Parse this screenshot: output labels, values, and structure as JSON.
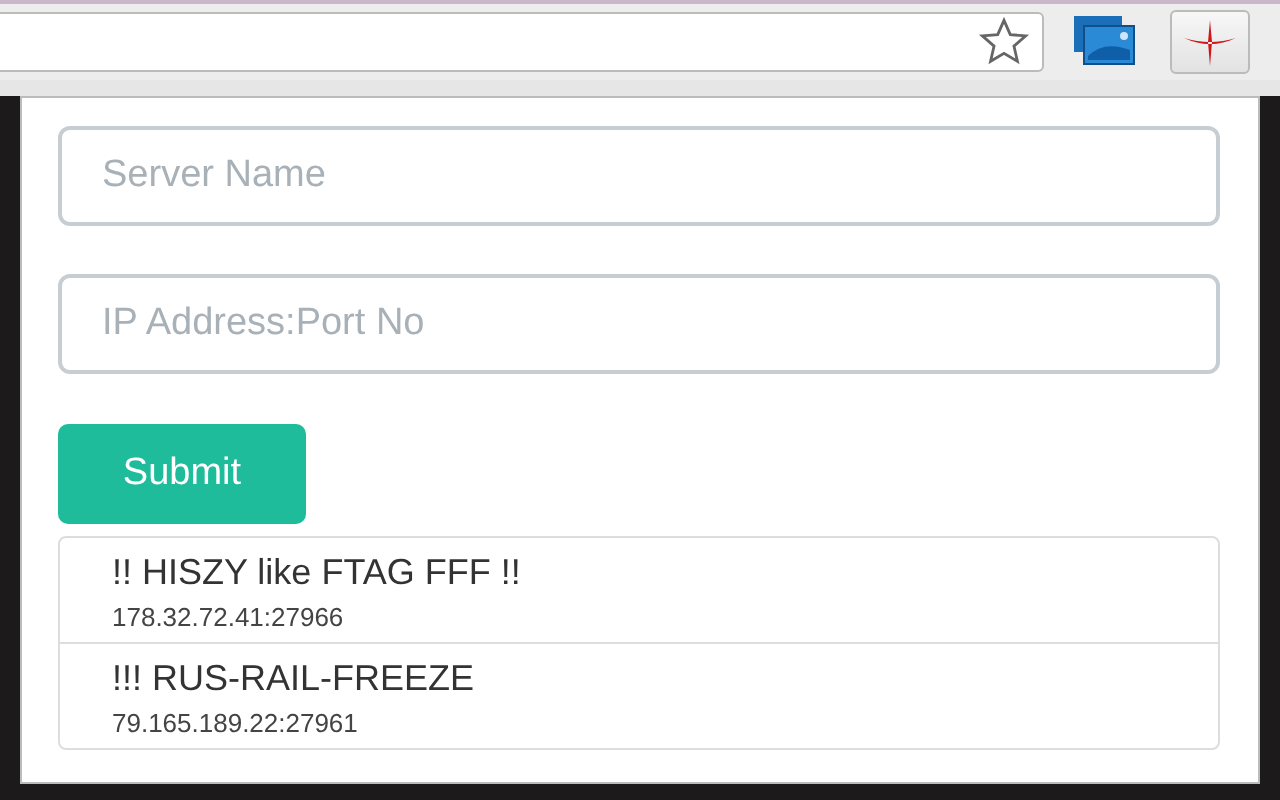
{
  "form": {
    "fields": [
      {
        "placeholder": "Server Name"
      },
      {
        "placeholder": "IP Address:Port No"
      }
    ],
    "submit": "Submit"
  },
  "servers": [
    {
      "name": "!! HISZY like FTAG FFF !!",
      "address": "178.32.72.41:27966"
    },
    {
      "name": "!!! RUS-RAIL-FREEZE",
      "address": "79.165.189.22:27961"
    }
  ]
}
